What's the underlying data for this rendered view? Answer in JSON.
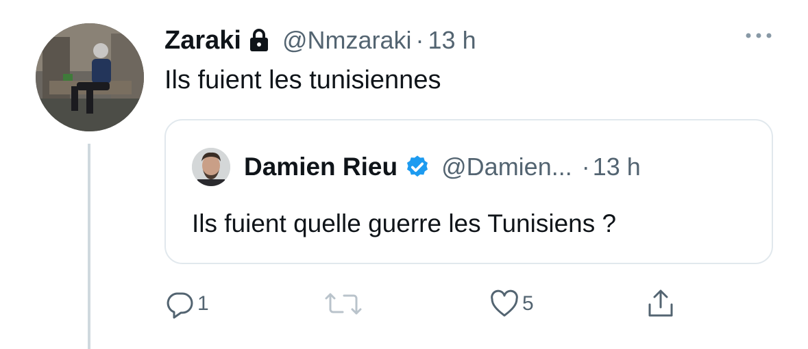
{
  "tweet": {
    "author_name": "Zaraki",
    "author_handle": "@Nmzaraki",
    "separator": "·",
    "time": "13 h",
    "text": "Ils fuient les tunisiennes",
    "icons": {
      "lock": "lock-icon",
      "more": "more-icon",
      "avatar": "avatar"
    }
  },
  "quote": {
    "author_name": "Damien Rieu",
    "author_handle": "@Damien...",
    "separator": "·",
    "time": "13 h",
    "text": "Ils fuient quelle guerre les Tunisiens ?",
    "verified_color": "#1d9bf0"
  },
  "actions": {
    "reply_count": "1",
    "retweet_count": "",
    "like_count": "5"
  },
  "colors": {
    "text": "#0f1419",
    "secondary": "#536471",
    "border": "#e1e8ed",
    "thread_line": "#cfd9de"
  }
}
